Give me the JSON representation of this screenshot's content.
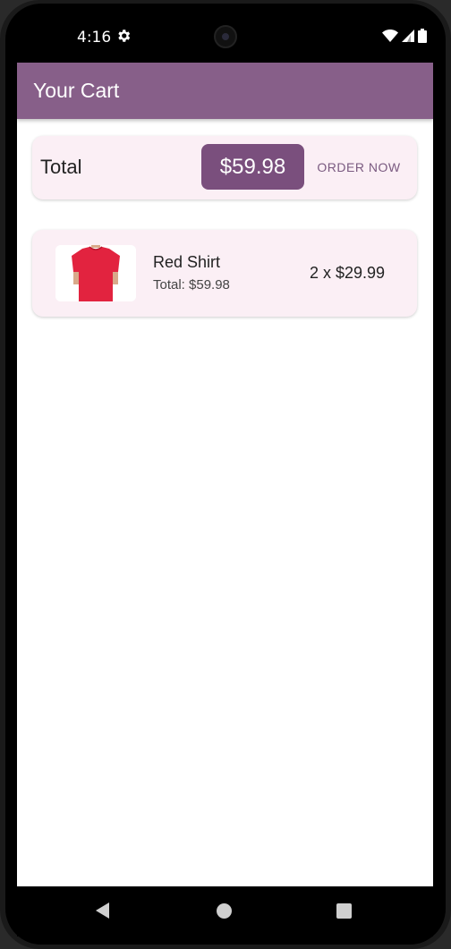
{
  "status_bar": {
    "time": "4:16"
  },
  "app_bar": {
    "title": "Your Cart"
  },
  "total_card": {
    "label": "Total",
    "amount": "$59.98",
    "order_button": "ORDER NOW"
  },
  "cart_items": [
    {
      "name": "Red Shirt",
      "subtotal": "Total: $59.98",
      "quantity_price": "2 x $29.99",
      "image_icon": "red-shirt-image"
    }
  ],
  "colors": {
    "app_bar": "#875f89",
    "chip": "#7a4f7d",
    "card_bg": "#fbeff5",
    "order_button_text": "#7a5a80"
  }
}
